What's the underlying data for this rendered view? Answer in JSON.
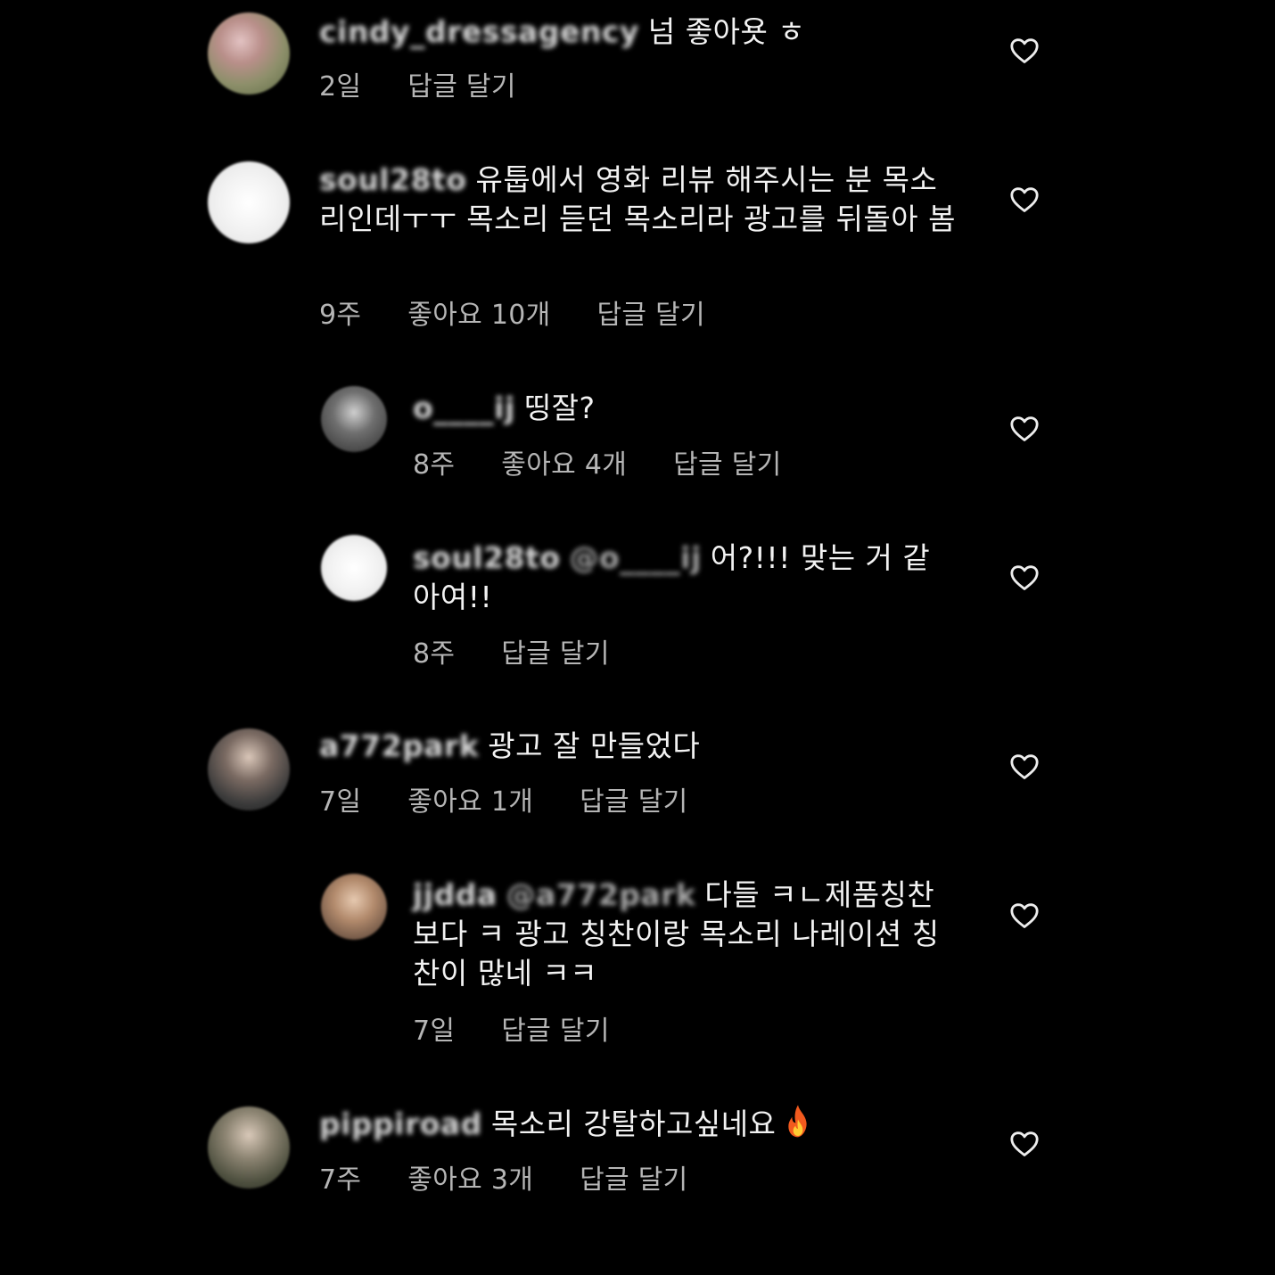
{
  "colors": {
    "background": "#000000",
    "text": "#f2f2f2",
    "meta": "#b5b5b5"
  },
  "icons": {
    "like": "heart-outline-icon",
    "emoji": "fire-emoji"
  },
  "comments": [
    {
      "username": "cindy_dressagency",
      "text": "넘 좋아욧 ㅎ",
      "time": "2일",
      "reply_label": "답글 달기"
    },
    {
      "username": "soul28to",
      "text": "유툽에서 영화 리뷰 해주시는 분 목소리인데ㅜㅜ 목소리 듣던 목소리라 광고를 뒤돌아 봄",
      "time": "9주",
      "likes": "좋아요 10개",
      "reply_label": "답글 달기"
    },
    {
      "username": "o____ij",
      "text": "띵잘?",
      "time": "8주",
      "likes": "좋아요 4개",
      "reply_label": "답글 달기"
    },
    {
      "username": "soul28to",
      "mention": "@o____ij",
      "text": "어?!!! 맞는 거 같아여!!",
      "time": "8주",
      "reply_label": "답글 달기"
    },
    {
      "username": "a772park",
      "text": "광고 잘 만들었다",
      "time": "7일",
      "likes": "좋아요 1개",
      "reply_label": "답글 달기"
    },
    {
      "username": "jjdda",
      "mention": "@a772park",
      "text": "다들 ㅋㄴ제품칭찬보다 ㅋ 광고 칭찬이랑 목소리 나레이션 칭찬이 많네 ㅋㅋ",
      "time": "7일",
      "reply_label": "답글 달기"
    },
    {
      "username": "pippiroad",
      "text": "목소리 강탈하고싶네요",
      "time": "7주",
      "likes": "좋아요 3개",
      "reply_label": "답글 달기"
    }
  ]
}
